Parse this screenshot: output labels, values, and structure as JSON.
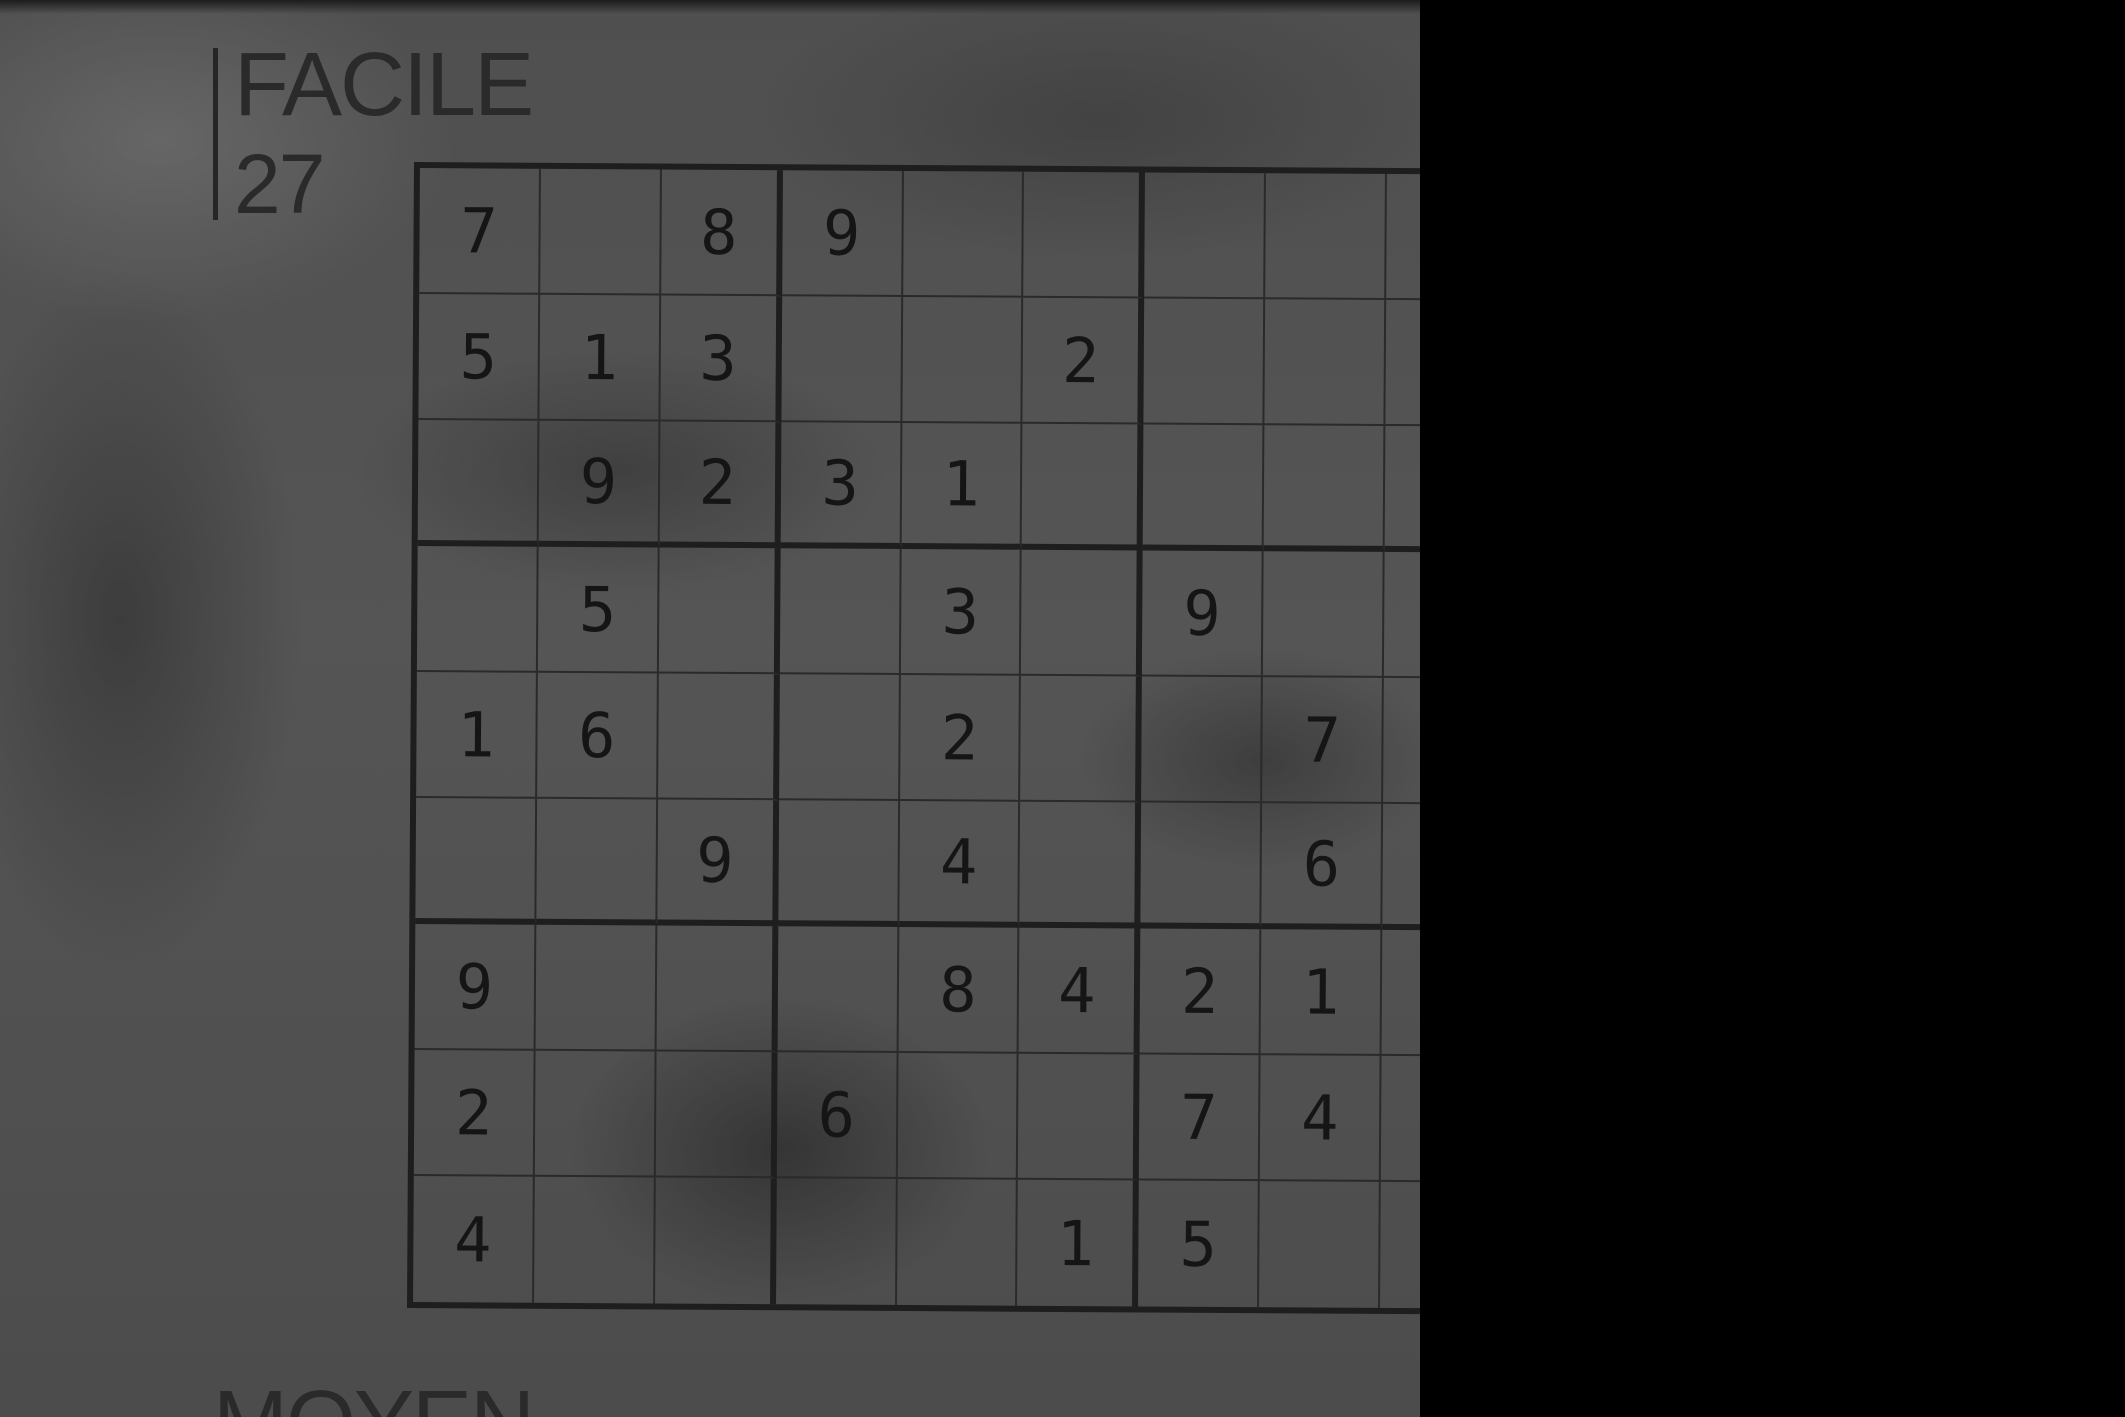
{
  "headings": {
    "difficulty": "FACILE",
    "puzzle_number": "27",
    "next_difficulty": "MOYEN"
  },
  "grid": [
    [
      "7",
      "",
      "8",
      "9",
      "",
      "",
      "",
      "",
      ""
    ],
    [
      "5",
      "1",
      "3",
      "",
      "",
      "2",
      "",
      "",
      ""
    ],
    [
      "",
      "9",
      "2",
      "3",
      "1",
      "",
      "",
      "",
      ""
    ],
    [
      "",
      "5",
      "",
      "",
      "3",
      "",
      "9",
      "",
      ""
    ],
    [
      "1",
      "6",
      "",
      "",
      "2",
      "",
      "",
      "7",
      ""
    ],
    [
      "",
      "",
      "9",
      "",
      "4",
      "",
      "",
      "6",
      ""
    ],
    [
      "9",
      "",
      "",
      "",
      "8",
      "4",
      "2",
      "1",
      ""
    ],
    [
      "2",
      "",
      "",
      "6",
      "",
      "",
      "7",
      "4",
      ""
    ],
    [
      "4",
      "",
      "",
      "",
      "",
      "1",
      "5",
      "",
      ""
    ]
  ],
  "colors": {
    "paper": "#525252",
    "ink": "#151515",
    "background": "#000000"
  }
}
